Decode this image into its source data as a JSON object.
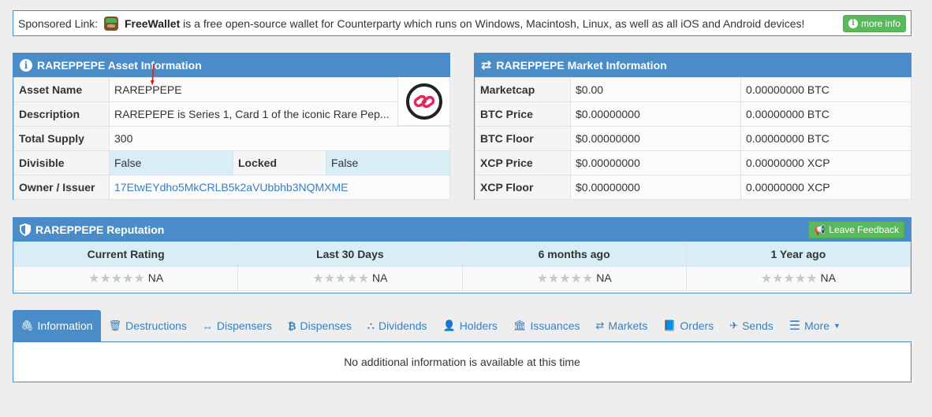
{
  "sponsor": {
    "prefix": "Sponsored Link:",
    "brand": "FreeWallet",
    "text": " is a free open-source wallet for Counterparty which runs on Windows, Macintosh, Linux, as well as all iOS and Android devices!",
    "button": "more info"
  },
  "asset": {
    "title": "RAREPPEPE Asset Information",
    "rows": {
      "name_label": "Asset Name",
      "name_value": "RAREPPEPE",
      "desc_label": "Description",
      "desc_value": "RAREPEPE is Series 1, Card 1 of the iconic Rare Pep...",
      "supply_label": "Total Supply",
      "supply_value": "300",
      "divisible_label": "Divisible",
      "divisible_value": "False",
      "locked_label": "Locked",
      "locked_value": "False",
      "owner_label": "Owner / Issuer",
      "owner_value": "17EtwEYdho5MkCRLB5k2aVUbbhb3NQMXME"
    }
  },
  "market": {
    "title": "RAREPPEPE Market Information",
    "rows": [
      {
        "label": "Marketcap",
        "usd": "$0.00",
        "alt": "0.00000000 BTC"
      },
      {
        "label": "BTC Price",
        "usd": "$0.00000000",
        "alt": "0.00000000 BTC"
      },
      {
        "label": "BTC Floor",
        "usd": "$0.00000000",
        "alt": "0.00000000 BTC"
      },
      {
        "label": "XCP Price",
        "usd": "$0.00000000",
        "alt": "0.00000000 XCP"
      },
      {
        "label": "XCP Floor",
        "usd": "$0.00000000",
        "alt": "0.00000000 XCP"
      }
    ]
  },
  "reputation": {
    "title": "RAREPPEPE Reputation",
    "button": "Leave Feedback",
    "columns": [
      "Current Rating",
      "Last 30 Days",
      "6 months ago",
      "1 Year ago"
    ],
    "values": [
      "NA",
      "NA",
      "NA",
      "NA"
    ]
  },
  "tabs": {
    "items": [
      "Information",
      "Destructions",
      "Dispensers",
      "Dispenses",
      "Dividends",
      "Holders",
      "Issuances",
      "Markets",
      "Orders",
      "Sends",
      "More"
    ],
    "body": "No additional information is available at this time"
  },
  "colors": {
    "accent": "#4a8cc7",
    "success": "#5cb85c",
    "background": "#eeeeee"
  }
}
